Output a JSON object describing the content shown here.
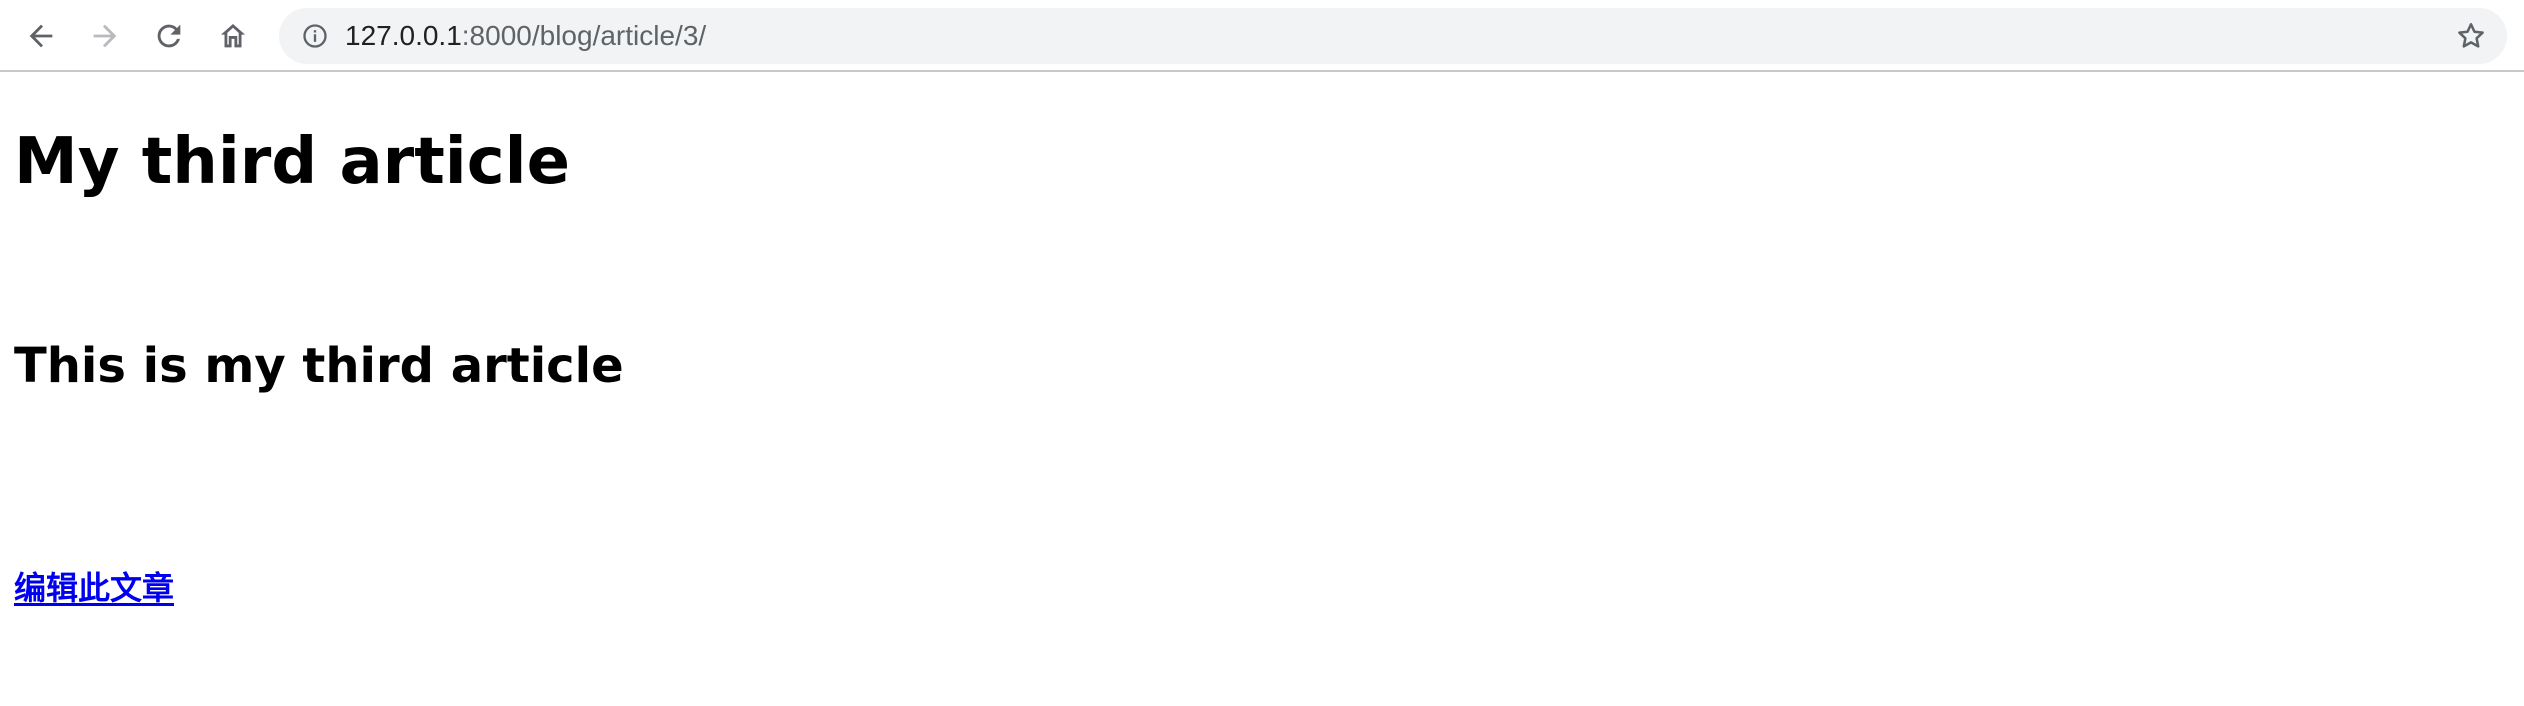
{
  "browser": {
    "url_host": "127.0.0.1",
    "url_path": ":8000/blog/article/3/",
    "icons": {
      "back": "back-arrow-icon",
      "forward": "forward-arrow-icon",
      "reload": "reload-icon",
      "home": "home-icon",
      "site_info": "info-icon",
      "bookmark": "star-icon"
    },
    "forward_enabled": false
  },
  "article": {
    "title": "My third article",
    "body": "This is my third article",
    "edit_link": "编辑此文章"
  },
  "colors": {
    "link": "#0000ee",
    "omnibox_bg": "#f1f3f4",
    "text": "#000000"
  }
}
